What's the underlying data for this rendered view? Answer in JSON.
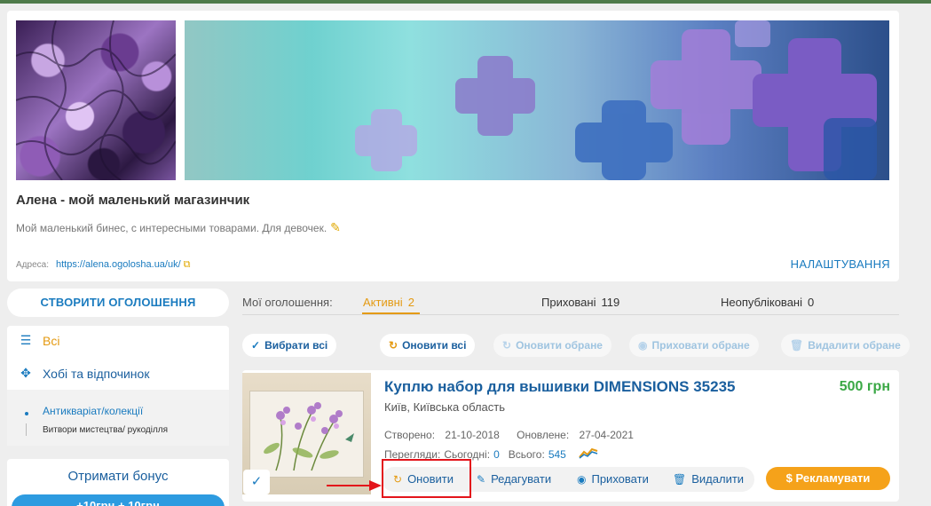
{
  "shop": {
    "title": "Алена - мой маленький магазинчик",
    "description": "Мой маленький бинес, с интересными товарами. Для девочек.",
    "address_label": "Адреса:",
    "address_url": "https://alena.ogolosha.ua/uk/",
    "settings_label": "НАЛАШТУВАННЯ"
  },
  "sidebar": {
    "create_label": "СТВОРИТИ ОГОЛОШЕННЯ",
    "categories": [
      {
        "label": "Всі",
        "icon": "list-icon"
      },
      {
        "label": "Хобі та відпочинок",
        "icon": "puzzle-icon"
      }
    ],
    "subcategories": [
      {
        "label": "Антикваріат/колекції"
      },
      {
        "label": "Витвори мистецтва/ рукоділля"
      }
    ],
    "bonus_title": "Отримати бонус",
    "bonus_button": "+10грн + 10грн"
  },
  "tabs": {
    "label": "Мої оголошення:",
    "items": [
      {
        "label": "Активні",
        "count": "2",
        "active": true
      },
      {
        "label": "Приховані",
        "count": "119",
        "active": false
      },
      {
        "label": "Неопубліковані",
        "count": "0",
        "active": false
      }
    ]
  },
  "actions": {
    "select_all": "Вибрати всі",
    "refresh_all": "Оновити всі",
    "refresh_selected": "Оновити обране",
    "hide_selected": "Приховати обране",
    "delete_selected": "Видалити обране"
  },
  "ad": {
    "title": "Куплю набор для вышивки DIMENSIONS 35235",
    "price": "500 грн",
    "location": "Київ, Київська область",
    "created_label": "Створено:",
    "created": "21-10-2018",
    "updated_label": "Оновлене:",
    "updated": "27-04-2021",
    "views_label": "Перегляди:",
    "today_label": "Сьогодні:",
    "today": "0",
    "total_label": "Всього:",
    "total": "545",
    "actions": {
      "refresh": "Оновити",
      "edit": "Редагувати",
      "hide": "Приховати",
      "delete": "Видалити"
    },
    "promote": "Рекламувати"
  },
  "colors": {
    "brand_blue": "#1a7bbf",
    "accent_orange": "#e49a12",
    "price_green": "#3aa845",
    "promote_orange": "#f5a21a",
    "highlight_red": "#e3141b"
  }
}
